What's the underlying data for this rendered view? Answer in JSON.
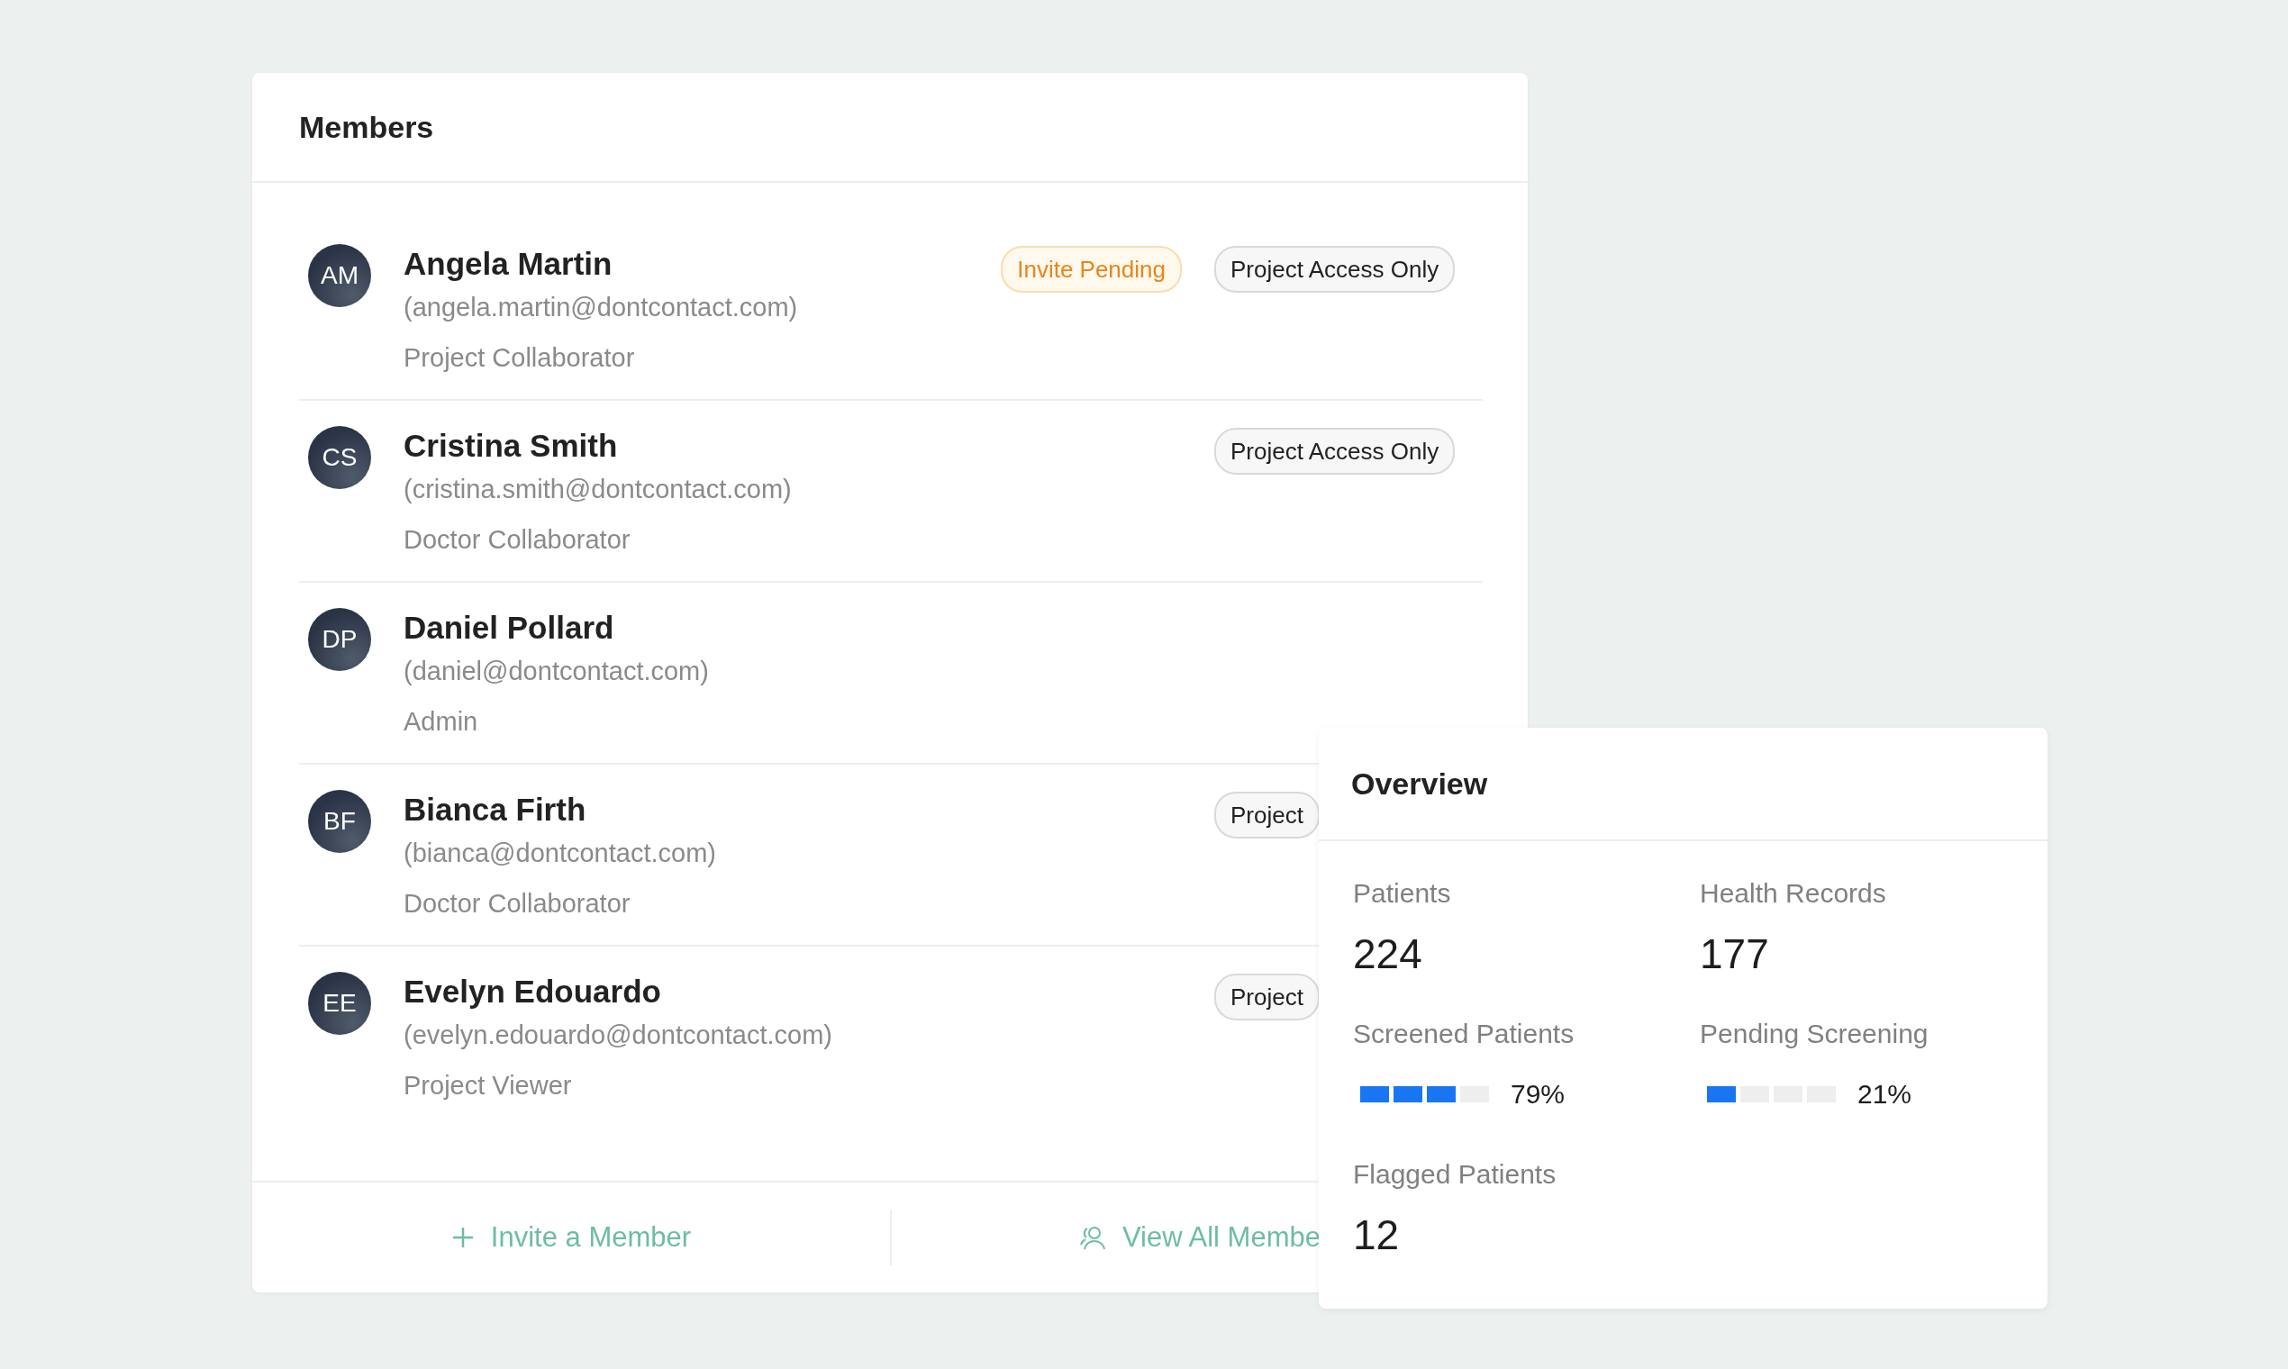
{
  "members": {
    "title": "Members",
    "rows": [
      {
        "initials": "AM",
        "name": "Angela Martin",
        "email": "(angela.martin@dontcontact.com)",
        "role": "Project Collaborator",
        "badges": [
          {
            "kind": "pending",
            "label": "Invite Pending"
          },
          {
            "kind": "access",
            "label": "Project Access Only"
          }
        ]
      },
      {
        "initials": "CS",
        "name": "Cristina Smith",
        "email": "(cristina.smith@dontcontact.com)",
        "role": "Doctor Collaborator",
        "badges": [
          {
            "kind": "access",
            "label": "Project Access Only"
          }
        ]
      },
      {
        "initials": "DP",
        "name": "Daniel Pollard",
        "email": "(daniel@dontcontact.com)",
        "role": "Admin"
      },
      {
        "initials": "BF",
        "name": "Bianca Firth",
        "email": "(bianca@dontcontact.com)",
        "role": "Doctor Collaborator",
        "badges": [
          {
            "kind": "access",
            "label": "Project"
          }
        ]
      },
      {
        "initials": "EE",
        "name": "Evelyn Edouardo",
        "email": "(evelyn.edouardo@dontcontact.com)",
        "role": "Project Viewer",
        "badges": [
          {
            "kind": "access",
            "label": "Project"
          }
        ]
      }
    ],
    "actions": [
      {
        "kind": "invite",
        "label": "Invite a Member"
      },
      {
        "kind": "view",
        "label": "View All Membe"
      }
    ]
  },
  "overview": {
    "title": "Overview",
    "stats": [
      {
        "kind": "number",
        "label": "Patients",
        "value": "224"
      },
      {
        "kind": "number",
        "label": "Health Records",
        "value": "177"
      },
      {
        "kind": "progress",
        "label": "Screened Patients",
        "level": 0.79,
        "reading": "79%"
      },
      {
        "kind": "progress",
        "label": "Pending Screening",
        "level": 0.21,
        "reading": "21%"
      },
      {
        "kind": "number",
        "label": "Flagged Patients",
        "value": "12"
      }
    ]
  }
}
